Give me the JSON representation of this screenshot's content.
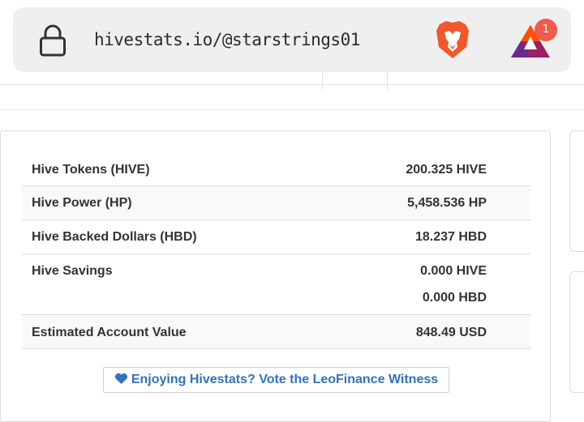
{
  "browser": {
    "url": "hivestats.io/@starstrings01",
    "rewards_badge": "1",
    "colors": {
      "bar_bg": "#efefef",
      "brave_orange": "#f1572b",
      "bat_badge": "#f05a4c"
    }
  },
  "wallet": {
    "rows": [
      {
        "label": "Hive Tokens (HIVE)",
        "values": [
          "200.325 HIVE"
        ]
      },
      {
        "label": "Hive Power (HP)",
        "values": [
          "5,458.536 HP"
        ]
      },
      {
        "label": "Hive Backed Dollars (HBD)",
        "values": [
          "18.237 HBD"
        ]
      },
      {
        "label": "Hive Savings",
        "values": [
          "0.000 HIVE",
          "0.000 HBD"
        ]
      },
      {
        "label": "Estimated Account Value",
        "values": [
          "848.49 USD"
        ]
      }
    ]
  },
  "vote": {
    "label": "Enjoying Hivestats? Vote the LeoFinance Witness",
    "icon": "heart-icon",
    "color": "#2f72c4"
  }
}
